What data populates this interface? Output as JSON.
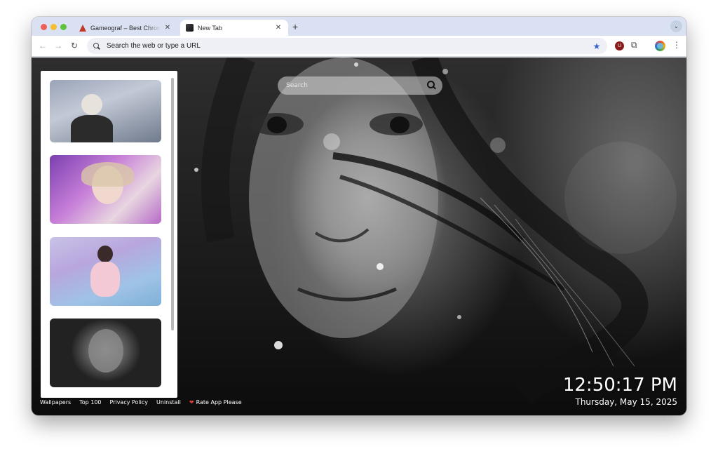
{
  "browser": {
    "tabs": [
      {
        "title": "Gameograf – Best Chrome Ext",
        "active": false
      },
      {
        "title": "New Tab",
        "active": true
      }
    ],
    "new_tab_label": "+",
    "omnibox_placeholder": "Search the web or type a URL",
    "extension_badge": "U"
  },
  "newtab": {
    "search": {
      "placeholder": "Search"
    },
    "clock": {
      "time": "12:50:17 PM",
      "date": "Thursday, May 15, 2025"
    },
    "footer": {
      "links": [
        "Wallpapers",
        "Top 100",
        "Privacy Policy",
        "Uninstall"
      ],
      "rate_label": "Rate App Please"
    },
    "sidebar": {
      "thumbnails": [
        {
          "subject": "archer-thumbnail"
        },
        {
          "subject": "pink-portrait-thumbnail"
        },
        {
          "subject": "pastel-seated-thumbnail"
        },
        {
          "subject": "monochrome-portrait-thumbnail"
        }
      ]
    }
  },
  "colors": {
    "tabstrip": "#d9e1f2",
    "accent_star": "#3563c9",
    "heart": "#e03b3b"
  }
}
